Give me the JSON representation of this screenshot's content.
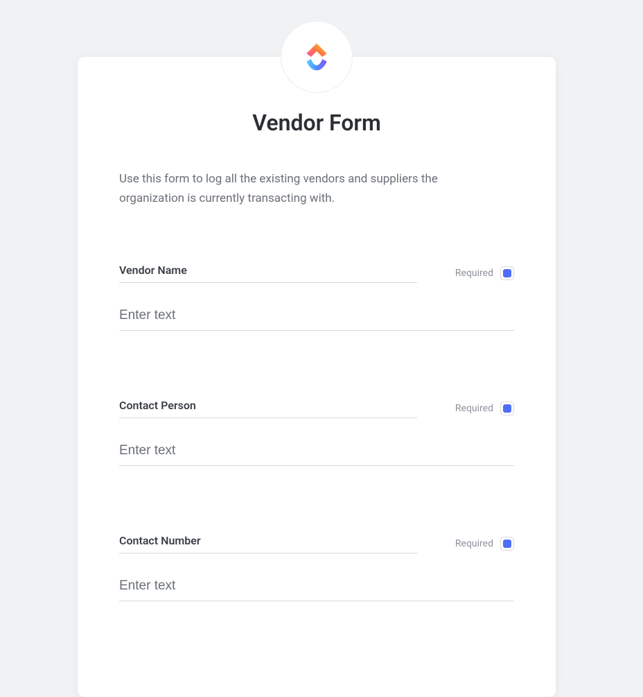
{
  "form": {
    "title": "Vendor Form",
    "description": "Use this form to log all the existing vendors and suppliers the organization is currently transacting with.",
    "required_label": "Required",
    "fields": [
      {
        "label": "Vendor Name",
        "placeholder": "Enter text",
        "required": true
      },
      {
        "label": "Contact Person",
        "placeholder": "Enter text",
        "required": true
      },
      {
        "label": "Contact Number",
        "placeholder": "Enter text",
        "required": true
      }
    ]
  },
  "branding": {
    "logo_name": "clickup-logo"
  }
}
